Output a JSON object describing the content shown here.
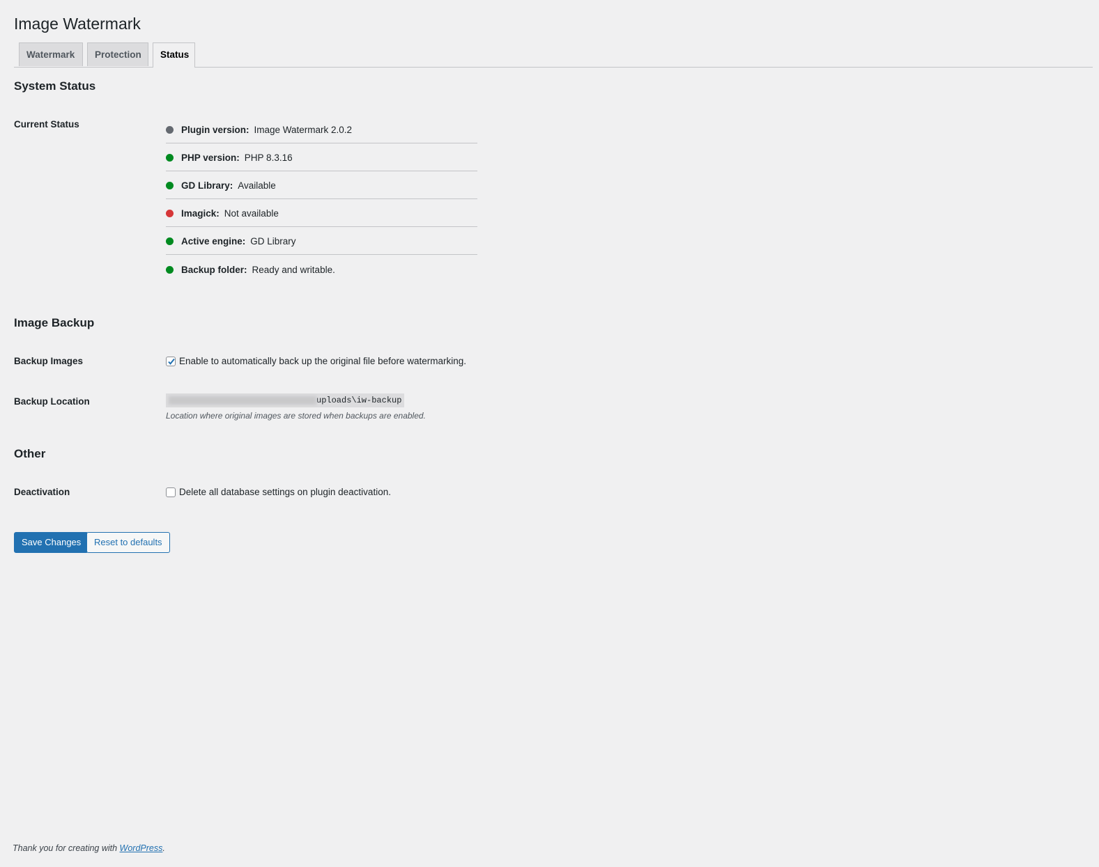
{
  "title": "Image Watermark",
  "tabs": [
    {
      "label": "Watermark"
    },
    {
      "label": "Protection"
    },
    {
      "label": "Status"
    }
  ],
  "system_status": {
    "heading": "System Status",
    "label": "Current Status",
    "items": [
      {
        "key": "Plugin version:",
        "value": "Image Watermark 2.0.2",
        "color": "#646970"
      },
      {
        "key": "PHP version:",
        "value": "PHP 8.3.16",
        "color": "#008a20"
      },
      {
        "key": "GD Library:",
        "value": "Available",
        "color": "#008a20"
      },
      {
        "key": "Imagick:",
        "value": "Not available",
        "color": "#d63638"
      },
      {
        "key": "Active engine:",
        "value": "GD Library",
        "color": "#008a20"
      },
      {
        "key": "Backup folder:",
        "value": "Ready and writable.",
        "color": "#008a20"
      }
    ]
  },
  "image_backup": {
    "heading": "Image Backup",
    "backup_images_label": "Backup Images",
    "backup_images_text": "Enable to automatically back up the original file before watermarking.",
    "backup_images_checked": true,
    "backup_location_label": "Backup Location",
    "backup_location_visible": "uploads\\iw-backup",
    "backup_location_desc": "Location where original images are stored when backups are enabled."
  },
  "other": {
    "heading": "Other",
    "deactivation_label": "Deactivation",
    "deactivation_text": "Delete all database settings on plugin deactivation.",
    "deactivation_checked": false
  },
  "buttons": {
    "save": "Save Changes",
    "reset": "Reset to defaults"
  },
  "footer": {
    "text": "Thank you for creating with ",
    "link": "WordPress",
    "suffix": "."
  }
}
